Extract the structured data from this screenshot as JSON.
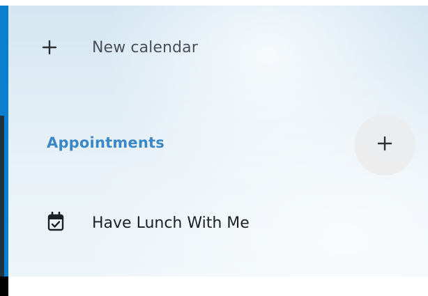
{
  "sidebar": {
    "new_calendar": {
      "label": "New calendar",
      "icon": "plus-icon"
    },
    "section": {
      "title": "Appointments",
      "add_icon": "plus-icon"
    },
    "appointments": [
      {
        "label": "Have Lunch With Me",
        "icon": "calendar-check-icon"
      }
    ]
  },
  "colors": {
    "accent": "#0a7fcd",
    "section_title": "#3b87c5",
    "text_primary": "#1c1f23",
    "text_secondary": "#4a4f55",
    "add_button_bg": "#ececec"
  }
}
